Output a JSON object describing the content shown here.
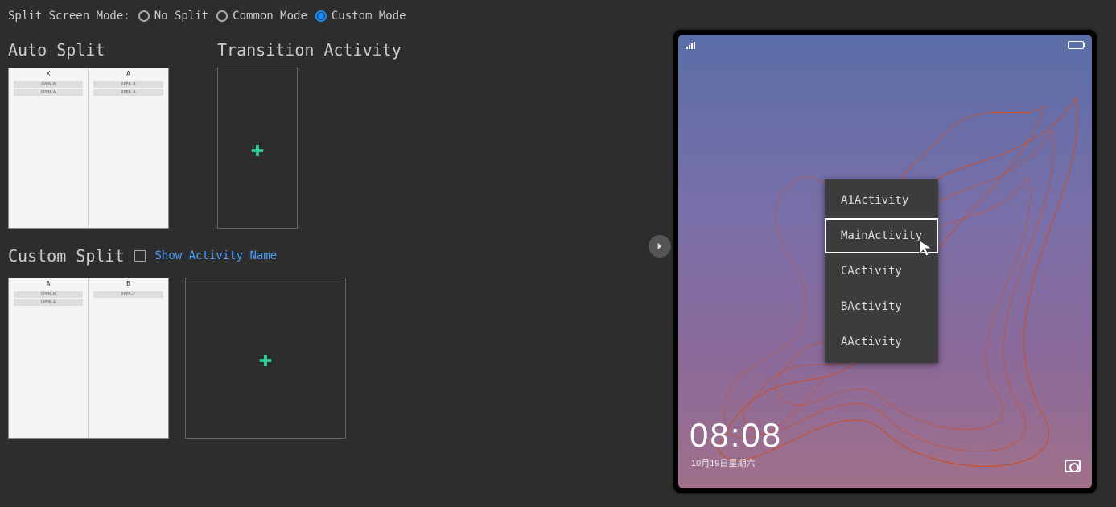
{
  "topbar": {
    "label": "Split Screen Mode:",
    "options": {
      "no_split": "No Split",
      "common_mode": "Common Mode",
      "custom_mode": "Custom Mode"
    },
    "selected": "custom_mode"
  },
  "sections": {
    "auto_split": "Auto Split",
    "transition_activity": "Transition Activity",
    "custom_split": "Custom Split"
  },
  "auto_split_panel": {
    "left_header": "X",
    "right_header": "A",
    "left_bars": [
      "OPEN-B",
      "OPEN-A"
    ],
    "right_bars": [
      "OPEN-B",
      "OPEN-A"
    ]
  },
  "custom_split": {
    "show_activity_name": "Show Activity Name",
    "checked": false,
    "left_header": "A",
    "right_header": "B",
    "left_bars": [
      "OPEN-B",
      "OPEN-A"
    ],
    "right_bars": [
      "OPEN-C"
    ]
  },
  "device": {
    "clock": "08:08",
    "date": "10月19日星期六",
    "activity_menu": [
      "A1Activity",
      "MainActivity",
      "CActivity",
      "BActivity",
      "AActivity"
    ],
    "selected_activity": "MainActivity"
  }
}
